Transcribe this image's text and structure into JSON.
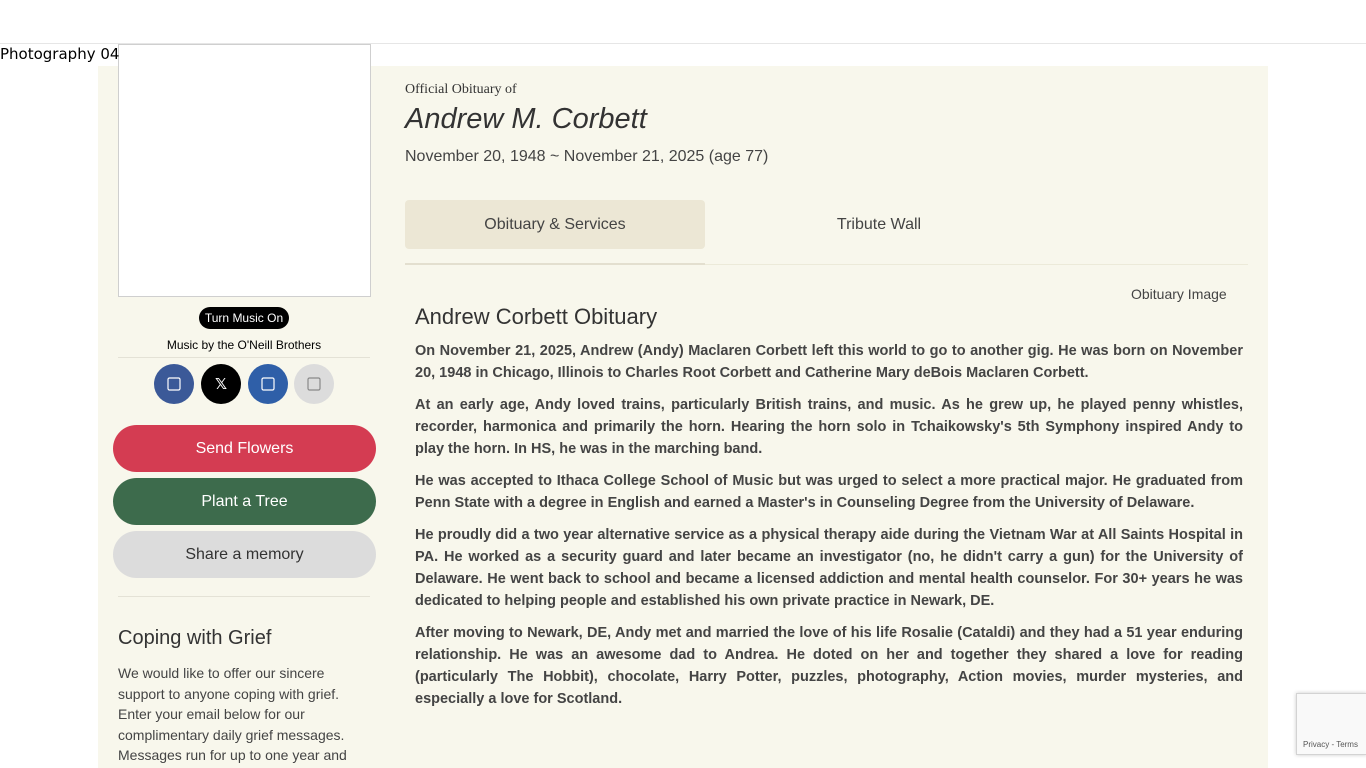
{
  "broken_photo_alt": "Photography 04",
  "sidebar": {
    "music_button": "Turn Music On",
    "music_credit": "Music by the O'Neill Brothers",
    "share_icons": [
      "facebook-icon",
      "x-twitter-icon",
      "linkedin-icon",
      "email-icon"
    ],
    "x_glyph": "𝕏",
    "send_flowers": "Send Flowers",
    "plant_tree": "Plant a Tree",
    "share_memory": "Share a memory",
    "grief_title": "Coping with Grief",
    "grief_text": "We would like to offer our sincere support to anyone coping with grief. Enter your email below for our complimentary daily grief messages. Messages run for up to one year and"
  },
  "header": {
    "official_label": "Official Obituary of",
    "name": "Andrew M. Corbett",
    "dates": "November 20, 1948 ~ November 21, 2025 (age 77)"
  },
  "tabs": [
    {
      "label": "Obituary & Services"
    },
    {
      "label": "Tribute Wall"
    }
  ],
  "obituary": {
    "image_alt": "Obituary Image",
    "title": "Andrew Corbett Obituary",
    "paragraphs": [
      "On November 21, 2025, Andrew (Andy) Maclaren Corbett left this world to go to another gig.  He was born on November 20, 1948 in Chicago, Illinois to Charles Root Corbett and Catherine Mary deBois Maclaren Corbett.",
      "At an early age, Andy loved trains, particularly British trains, and music. As he grew up, he played penny whistles, recorder, harmonica and primarily the horn.   Hearing the horn solo in Tchaikowsky's 5th Symphony inspired Andy to play the horn.  In HS, he was in the marching band.",
      "He was accepted to Ithaca College School of Music but was urged to select a more practical major.  He graduated from Penn State with a degree in English and earned a Master's in Counseling Degree from the University of Delaware.",
      "He proudly did a two year alternative service as a physical therapy aide during the Vietnam War at All Saints Hospital in PA.  He worked as a security guard and later became an investigator (no, he didn't carry a gun) for the University of Delaware.  He went back to school and became a licensed addiction and mental health counselor.  For 30+ years he was dedicated to helping people and established his own private practice in Newark, DE.",
      "After moving to Newark, DE, Andy met and married the love of his life Rosalie (Cataldi) and they had a 51 year enduring relationship.  He was an awesome dad to Andrea.  He doted on her and together they shared a love for reading (particularly The Hobbit), chocolate, Harry Potter, puzzles, photography, Action movies, murder mysteries, and especially a love for Scotland."
    ]
  },
  "recaptcha": {
    "links": "Privacy - Terms"
  }
}
